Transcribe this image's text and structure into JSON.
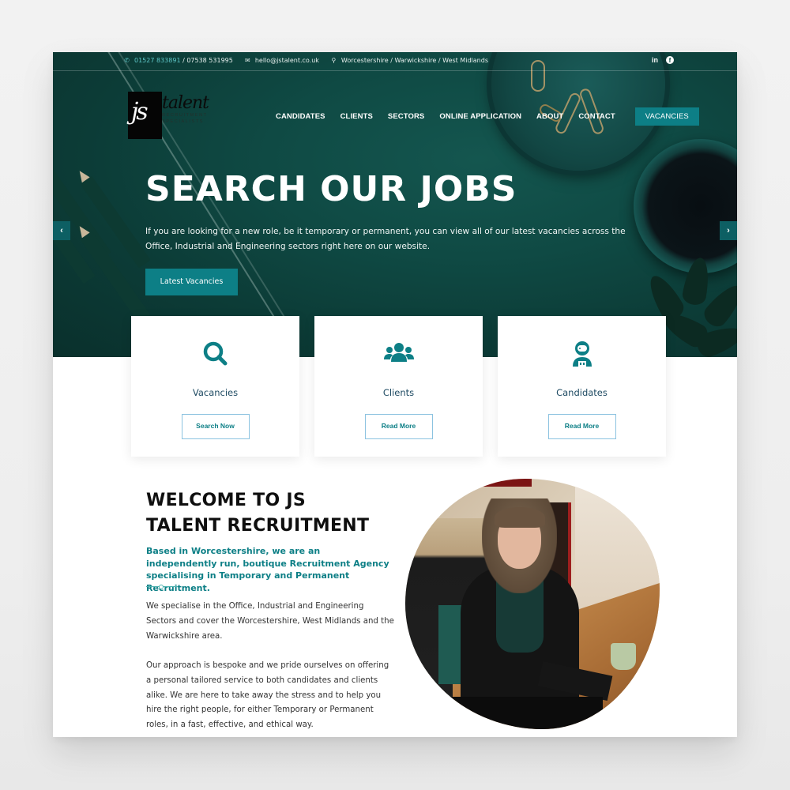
{
  "topbar": {
    "phone_primary": "01527 833891",
    "phone_separator": " / ",
    "phone_secondary": "07538 531995",
    "email": "hello@jstalent.co.uk",
    "location": "Worcestershire / Warwickshire / West Midlands",
    "icons": {
      "phone": "phone-icon",
      "email": "envelope-icon",
      "location": "map-marker-icon"
    },
    "social": {
      "linkedin": "in",
      "facebook": "f"
    }
  },
  "logo": {
    "mark": "js",
    "word": "talent",
    "line1": "RECRUITMENT",
    "line2": "SPECIALISTS"
  },
  "nav": {
    "items": [
      "CANDIDATES",
      "CLIENTS",
      "SECTORS",
      "ONLINE APPLICATION",
      "ABOUT",
      "CONTACT"
    ],
    "cta": "VACANCIES"
  },
  "hero": {
    "title": "SEARCH OUR JOBS",
    "description": "If you are looking for a new role, be it temporary or permanent, you can view all of our latest vacancies across the Office, Industrial and Engineering sectors right here on our website.",
    "button": "Latest Vacancies",
    "prev_arrow": "‹",
    "next_arrow": "›"
  },
  "cards": [
    {
      "icon": "search-icon",
      "title": "Vacancies",
      "button": "Search Now"
    },
    {
      "icon": "users-icon",
      "title": "Clients",
      "button": "Read More"
    },
    {
      "icon": "user-astronaut-icon",
      "title": "Candidates",
      "button": "Read More"
    }
  ],
  "welcome": {
    "title_line1": "WELCOME TO JS",
    "title_line2": "TALENT RECRUITMENT",
    "subtitle": "Based in Worcestershire, we are an independently run, boutique Recruitment Agency specialising in Temporary and Permanent Recruitment.",
    "paragraph1": "We specialise in the Office, Industrial and Engineering Sectors and cover the Worcestershire, West Midlands and the Warwickshire area.",
    "paragraph2": "Our approach is bespoke and we pride ourselves on offering a personal tailored service to both candidates and clients alike. We are here to take away the stress and to help you hire the right people, for either Temporary or Permanent roles, in a fast, effective, and ethical way."
  },
  "colors": {
    "brand_teal": "#0d7f86",
    "hero_dark": "#0f4a44",
    "card_title": "#1f4b63",
    "button_border": "#8cc3e0"
  }
}
